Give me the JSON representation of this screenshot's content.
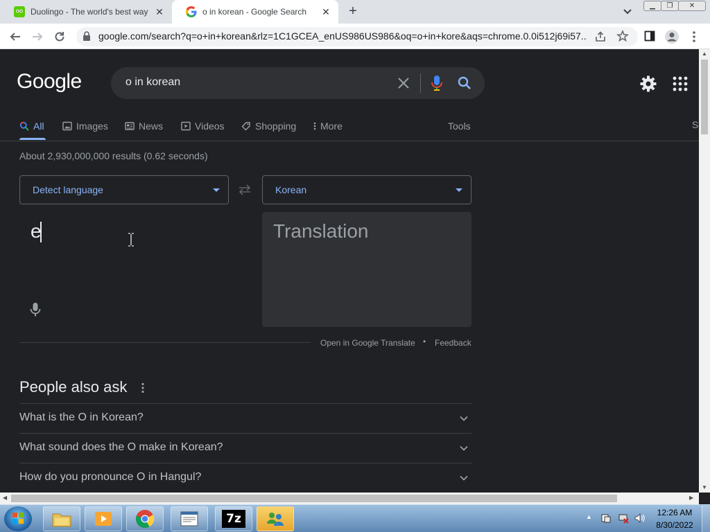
{
  "browser": {
    "tabs": [
      {
        "title": "Duolingo - The world's best way",
        "icon": "duolingo-icon"
      },
      {
        "title": "o in korean - Google Search",
        "icon": "google-icon"
      }
    ],
    "url": "google.com/search?q=o+in+korean&rlz=1C1GCEA_enUS986US986&oq=o+in+kore&aqs=chrome.0.0i512j69i57..."
  },
  "google": {
    "logo": "Google",
    "query": "o in korean",
    "tabs": [
      "All",
      "Images",
      "News",
      "Videos",
      "Shopping",
      "More"
    ],
    "tools_label": "Tools",
    "cut_tab": "S",
    "result_stats": "About 2,930,000,000 results (0.62 seconds)"
  },
  "translate": {
    "source_language": "Detect language",
    "target_language": "Korean",
    "source_text": "e",
    "translation_placeholder": "Translation",
    "open_link": "Open in Google Translate",
    "separator": "•",
    "feedback": "Feedback"
  },
  "people_also_ask": {
    "title": "People also ask",
    "questions": [
      "What is the O in Korean?",
      "What sound does the O make in Korean?",
      "How do you pronounce O in Hangul?"
    ]
  },
  "taskbar": {
    "time": "12:26 AM",
    "date": "8/30/2022",
    "apps": [
      "file-explorer-icon",
      "media-player-icon",
      "chrome-icon",
      "document-icon",
      "7zip-icon",
      "network-people-icon"
    ],
    "sevenzip_label": "7z"
  },
  "colors": {
    "page_bg": "#202124",
    "accent": "#8ab4f8",
    "search_box": "#303134"
  }
}
